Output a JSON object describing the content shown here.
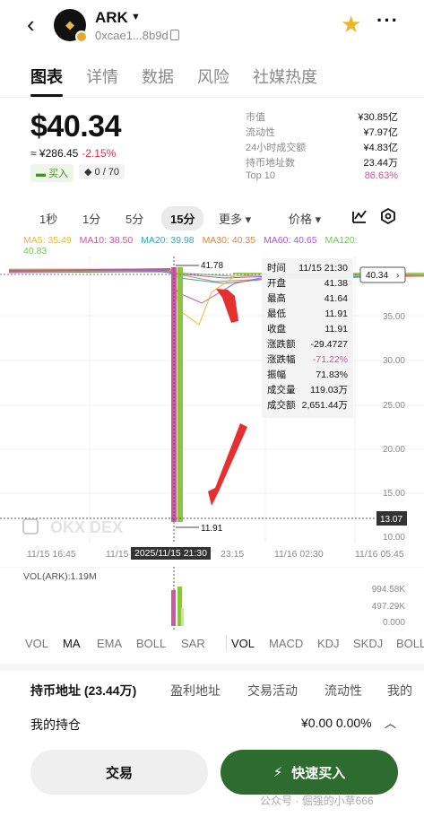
{
  "header": {
    "token": "ARK",
    "address": "0xcae1...8b9d"
  },
  "tabs": [
    "图表",
    "详情",
    "数据",
    "风险",
    "社媒热度"
  ],
  "price": {
    "main": "$40.34",
    "cny": "≈ ¥286.45",
    "change": "-2.15%",
    "buy_tag": "买入",
    "holders_tag": "0 / 70"
  },
  "stats": [
    {
      "k": "市值",
      "v": "¥30.85亿"
    },
    {
      "k": "流动性",
      "v": "¥7.97亿"
    },
    {
      "k": "24小时成交额",
      "v": "¥4.83亿"
    },
    {
      "k": "持币地址数",
      "v": "23.44万"
    },
    {
      "k": "Top 10",
      "v": "86.63%"
    }
  ],
  "timeframes": {
    "t1": "1秒",
    "t2": "1分",
    "t3": "5分",
    "t4": "15分",
    "more": "更多",
    "price": "价格"
  },
  "ma": {
    "ma5": "MA5: 35.49",
    "ma10": "MA10: 38.50",
    "ma20": "MA20: 39.98",
    "ma30": "MA30: 40.35",
    "ma60": "MA60: 40.65",
    "ma120": "MA120:",
    "ma120v": "40.83",
    "colors": {
      "ma5": "#e5b93a",
      "ma10": "#c8559c",
      "ma20": "#3aa5b8",
      "ma30": "#d2894a",
      "ma60": "#a35ad0",
      "ma120": "#7ac35d"
    }
  },
  "chart_data": {
    "type": "candlestick",
    "y_ticks": [
      "35.00",
      "30.00",
      "25.00",
      "20.00",
      "15.00",
      "10.00"
    ],
    "current_price_label": "40.34",
    "cursor_price_label": "13.07",
    "high_label": "41.78",
    "low_label": "11.91",
    "x_ticks": [
      "11/15 16:45",
      "11/15",
      "23:15",
      "11/16 02:30",
      "11/16 05:45"
    ],
    "cursor_time": "2025/11/15 21:30",
    "tooltip": [
      {
        "k": "时间",
        "v": "11/15 21:30"
      },
      {
        "k": "开盘",
        "v": "41.38"
      },
      {
        "k": "最高",
        "v": "41.64"
      },
      {
        "k": "最低",
        "v": "11.91"
      },
      {
        "k": "收盘",
        "v": "11.91"
      },
      {
        "k": "涨跌额",
        "v": "-29.4727"
      },
      {
        "k": "涨跌幅",
        "v": "-71.22%"
      },
      {
        "k": "振幅",
        "v": "71.83%"
      },
      {
        "k": "成交量",
        "v": "119.03万"
      },
      {
        "k": "成交额",
        "v": "2,651.44万"
      }
    ],
    "watermark": "OKX DEX",
    "volume_label": "VOL(ARK):1.19M",
    "volume_ticks": [
      "994.58K",
      "497.29K",
      "0.000"
    ]
  },
  "indicators": [
    "VOL",
    "MA",
    "EMA",
    "BOLL",
    "SAR",
    "VOL",
    "MACD",
    "KDJ",
    "SKDJ",
    "BOLL"
  ],
  "bottom_tabs": [
    "持币地址 (23.44万)",
    "盈利地址",
    "交易活动",
    "流动性",
    "我的"
  ],
  "holding": {
    "label": "我的持仓",
    "value": "¥0.00 0.00%"
  },
  "buttons": {
    "trade": "交易",
    "quick_buy": "快速买入"
  },
  "footer_watermark": "公众号 · 倔强的小草666"
}
